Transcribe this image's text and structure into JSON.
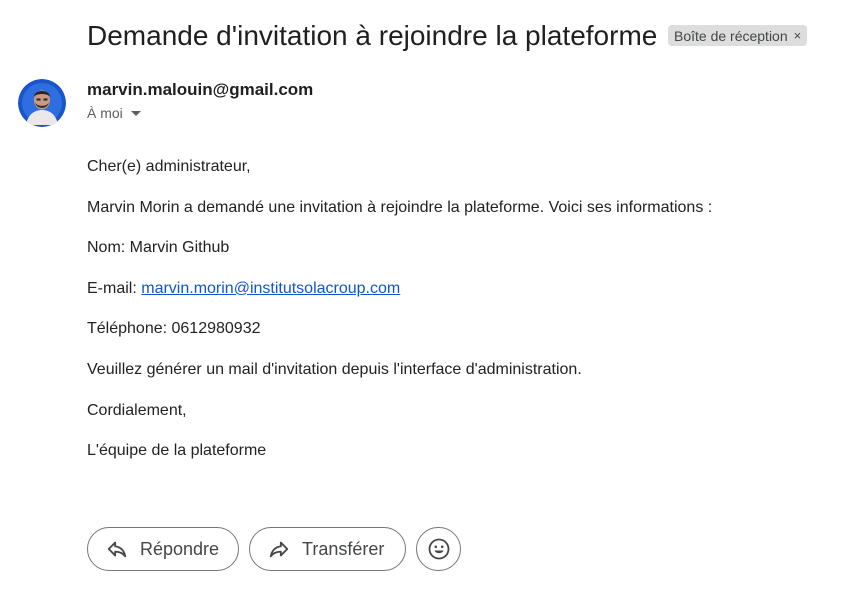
{
  "email": {
    "subject": "Demande d'invitation à rejoindre la plateforme",
    "label": "Boîte de réception",
    "label_close": "×",
    "sender": "marvin.malouin@gmail.com",
    "to": "À moi",
    "body": {
      "greeting": "Cher(e) administrateur,",
      "intro": "Marvin Morin a demandé une invitation à rejoindre la plateforme. Voici ses informations :",
      "name_line": "Nom: Marvin Github",
      "email_prefix": "E-mail: ",
      "email_link": "marvin.morin@institutsolacroup.com",
      "phone_line": "Téléphone: 0612980932",
      "request": "Veuillez générer un mail d'invitation depuis l'interface d'administration.",
      "closing": "Cordialement,",
      "signature": "L'équipe de la plateforme"
    }
  },
  "actions": {
    "reply_label": "Répondre",
    "forward_label": "Transférer",
    "reply_icon": "reply-icon",
    "forward_icon": "forward-icon",
    "emoji_icon": "emoji-icon"
  },
  "colors": {
    "avatar_ring": "#1a56c9",
    "link": "#1155cc",
    "chip_bg": "#dddddd"
  }
}
